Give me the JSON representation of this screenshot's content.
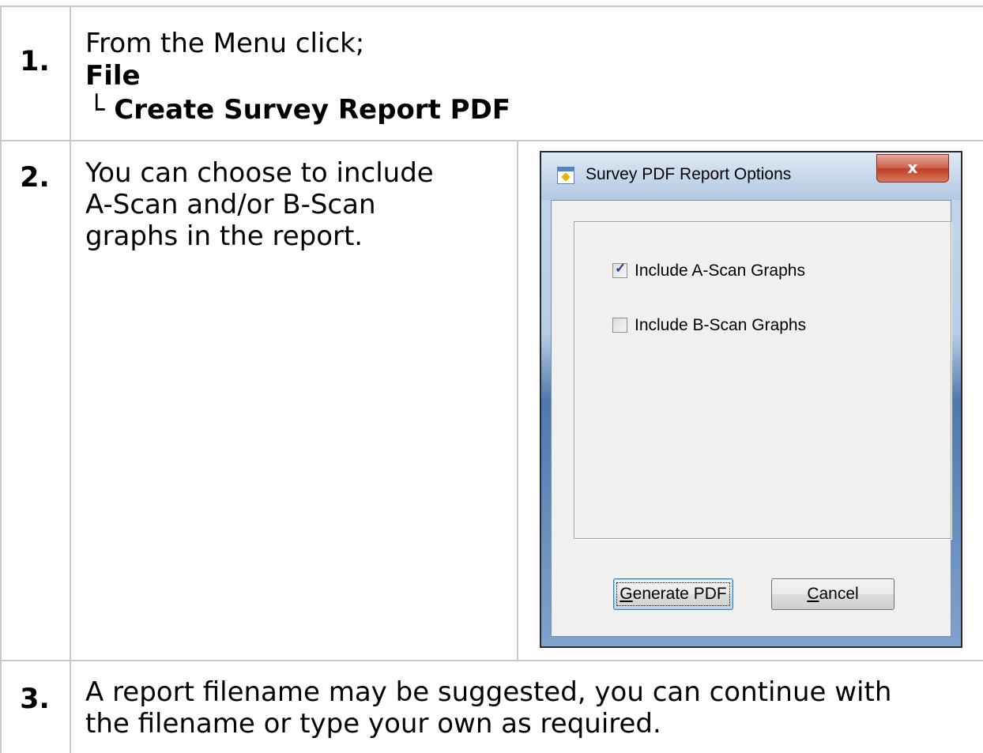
{
  "steps": [
    {
      "number": "1.",
      "text": "From the Menu click;",
      "menu_path": [
        "File",
        "└ Create Survey Report PDF"
      ]
    },
    {
      "number": "2.",
      "text_lines": [
        "You can choose to include",
        "A-Scan and/or B-Scan",
        "graphs in the report."
      ]
    },
    {
      "number": "3.",
      "text_lines": [
        "A report filename may be suggested, you can continue with",
        "the filename or type your own as required."
      ]
    }
  ],
  "dialog": {
    "title": "Survey PDF Report Options",
    "close_label": "x",
    "options": [
      {
        "label": "Include A-Scan Graphs",
        "checked": true
      },
      {
        "label": "Include B-Scan Graphs",
        "checked": false
      }
    ],
    "generate_button": {
      "mnemonic": "G",
      "rest": "enerate PDF"
    },
    "cancel_button": {
      "mnemonic": "C",
      "rest": "ancel"
    }
  }
}
